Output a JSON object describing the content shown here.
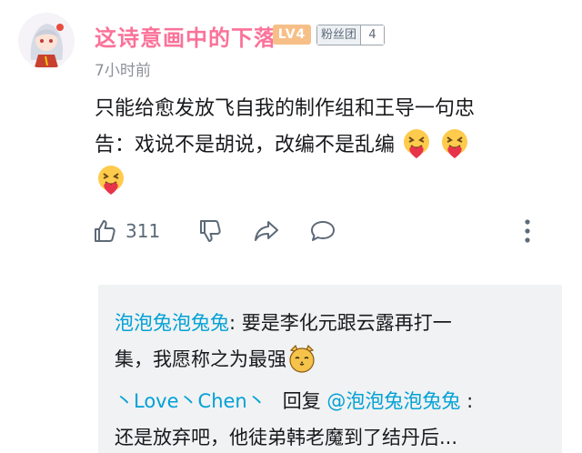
{
  "comment": {
    "username": "这诗意画中的下落",
    "level_badge": "LV4",
    "fan_badge": {
      "name": "粉丝团",
      "level": "4"
    },
    "time": "7小时前",
    "text_line1": "只能给愈发放飞自我的制作组和王导一句忠",
    "text_line2": "告：戏说不是胡说，改编不是乱编",
    "emoji": "heart-hug-emoji"
  },
  "actions": {
    "like_count": "311"
  },
  "replies": [
    {
      "author": "泡泡兔泡兔兔",
      "sep": ": ",
      "text_line1": "要是李化元跟云露再打一",
      "text_line2": "集，我愿称之为最强",
      "emoji": "cat-emoji"
    },
    {
      "author": "丶Love丶Chen丶",
      "reply_word": "回复",
      "mention": "@泡泡兔泡兔兔",
      "sep": " :",
      "text_line2": "还是放弃吧，他徒弟韩老魔到了结丹后..."
    }
  ],
  "colors": {
    "username": "#fb7299",
    "link": "#00a1d6",
    "reply_bg": "#f1f2f3",
    "level_badge": "#f7bf88"
  }
}
